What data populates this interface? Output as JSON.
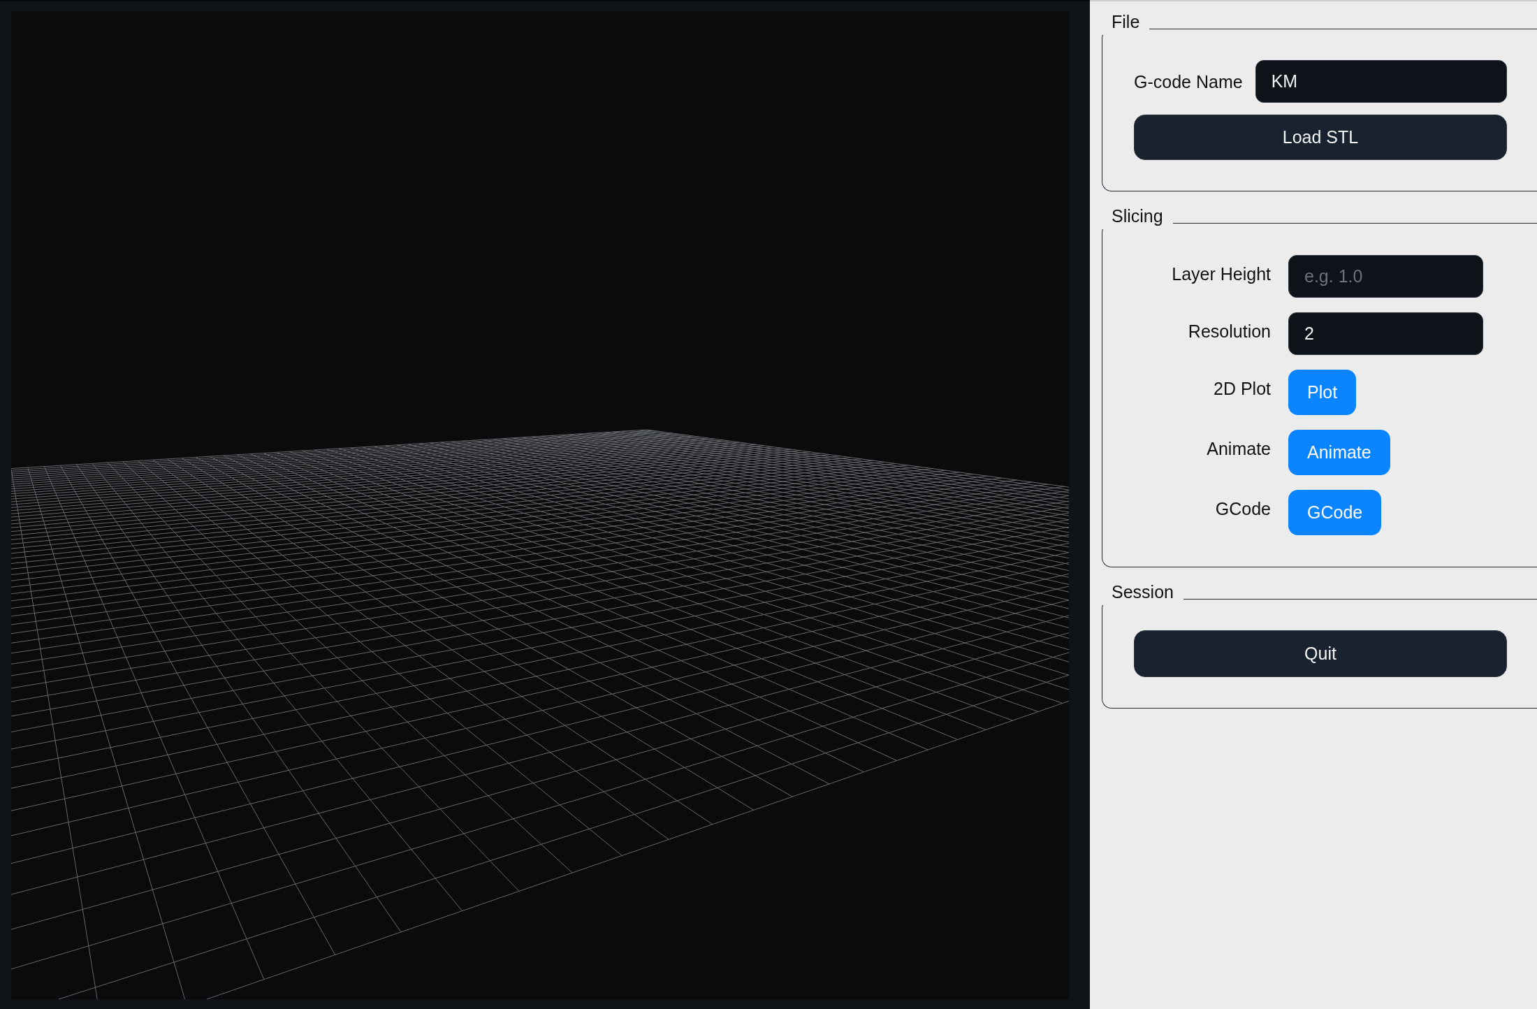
{
  "file": {
    "title": "File",
    "field": {
      "label": "G-code Name",
      "value": "KM"
    },
    "button": "Load STL"
  },
  "slicing": {
    "title": "Slicing",
    "rows": [
      {
        "kind": "input",
        "label": "Layer Height",
        "placeholder": "e.g. 1.0"
      },
      {
        "kind": "input",
        "label": "Resolution",
        "value": "2"
      },
      {
        "kind": "button",
        "label": "2D Plot",
        "button": "Plot"
      },
      {
        "kind": "button",
        "label": "Animate",
        "button": "Animate"
      },
      {
        "kind": "button",
        "label": "GCode",
        "button": "GCode"
      }
    ]
  },
  "session": {
    "title": "Session",
    "button": "Quit"
  }
}
